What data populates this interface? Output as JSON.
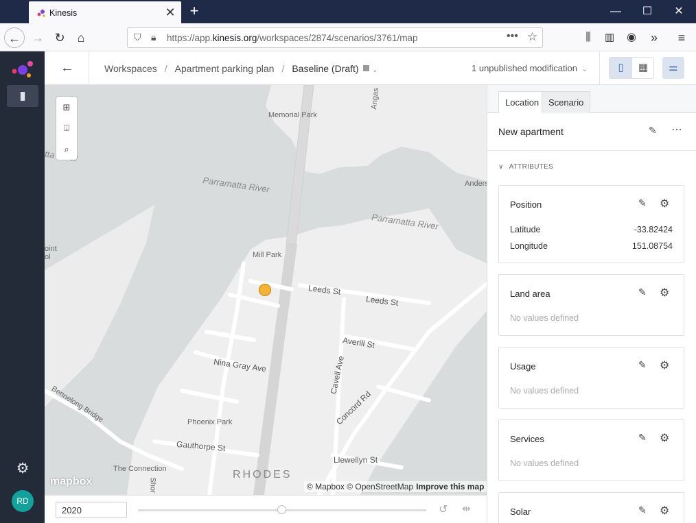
{
  "browser": {
    "tab_title": "Kinesis",
    "url_prefix": "https://app.",
    "url_domain": "kinesis.org",
    "url_path": "/workspaces/2874/scenarios/3761/map"
  },
  "header": {
    "crumbs": [
      "Workspaces",
      "Apartment parking plan",
      "Baseline (Draft)"
    ],
    "unpublished": "1 unpublished modification"
  },
  "user": {
    "initials": "RD",
    "avatar_color": "#13a29b"
  },
  "map": {
    "labels": {
      "memorial_park": "Memorial Park",
      "parramatta_1": "Parramatta River",
      "parramatta_2": "Parramatta River",
      "mill_park": "Mill Park",
      "leeds_1": "Leeds St",
      "leeds_2": "Leeds St",
      "averill": "Averill St",
      "cavell": "Cavell Ave",
      "nina": "Nina Gray Ave",
      "concord": "Concord Rd",
      "bennelong": "Bennelong Bridge",
      "phoenix": "Phoenix Park",
      "gauthorpe": "Gauthorpe St",
      "llewellyn": "Llewellyn St",
      "connection": "The Connection",
      "rhodes": "RHODES",
      "point_school_1": "oint",
      "point_school_2": "ol",
      "ander": "Anders",
      "tta_river": "tta River",
      "angas": "Angas",
      "shor": "Shor"
    },
    "logo": "mapbox",
    "attribution": "© Mapbox © OpenStreetMap",
    "improve": "Improve this map",
    "marker_color": "#f5b335"
  },
  "timeline": {
    "year": "2020"
  },
  "panel": {
    "tabs": [
      "Location",
      "Scenario"
    ],
    "location_name": "New apartment",
    "attributes_header": "ATTRIBUTES",
    "cards": [
      {
        "title": "Position",
        "rows": [
          {
            "key": "Latitude",
            "value": "-33.82424"
          },
          {
            "key": "Longitude",
            "value": "151.08754"
          }
        ]
      },
      {
        "title": "Land area",
        "empty": "No values defined"
      },
      {
        "title": "Usage",
        "empty": "No values defined"
      },
      {
        "title": "Services",
        "empty": "No values defined"
      },
      {
        "title": "Solar"
      }
    ]
  }
}
